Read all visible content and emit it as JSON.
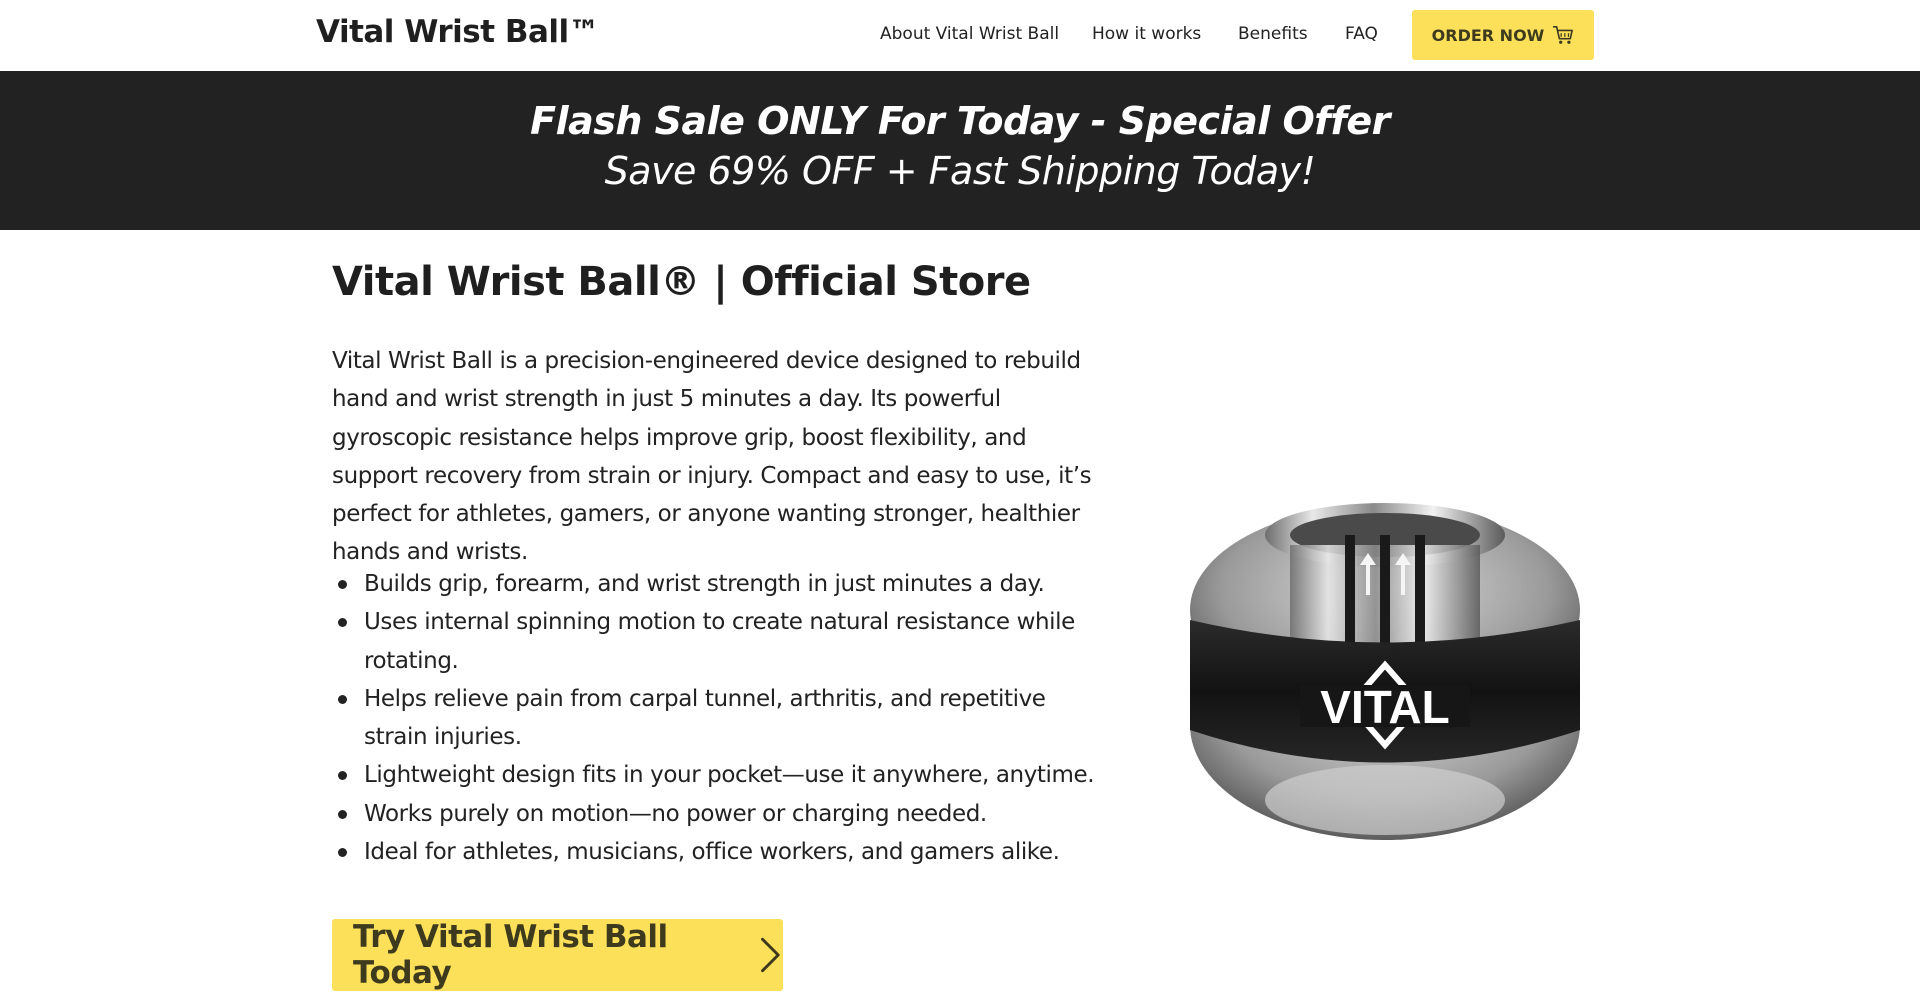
{
  "header": {
    "logo": "Vital Wrist Ball™",
    "nav": [
      "About Vital Wrist Ball",
      "How it works",
      "Benefits",
      "FAQ"
    ],
    "order_button": "ORDER NOW",
    "order_icon": "cart-icon"
  },
  "banner": {
    "line1": "Flash Sale ONLY For Today - Special Offer",
    "line2": "Save 69% OFF + Fast Shipping Today!"
  },
  "main": {
    "title": "Vital Wrist Ball® | Official Store",
    "description": "Vital Wrist Ball is a precision-engineered device designed to rebuild hand and wrist strength in just 5 minutes a day. Its powerful gyroscopic resistance helps improve grip, boost flexibility, and support recovery from strain or injury. Compact and easy to use, it’s perfect for athletes, gamers, or anyone wanting stronger, healthier hands and wrists.",
    "features": [
      "Builds grip, forearm, and wrist strength in just minutes a day.",
      "Uses internal spinning motion to create natural resistance while rotating.",
      "Helps relieve pain from carpal tunnel, arthritis, and repetitive strain injuries.",
      "Lightweight design fits in your pocket—use it anywhere, anytime.",
      "Works purely on motion—no power or charging needed.",
      "Ideal for athletes, musicians, office workers, and gamers alike."
    ],
    "cta_button": "Try Vital Wrist Ball Today",
    "cta_icon": "chevron-right-icon"
  },
  "product_image": {
    "brand_text": "VITAL"
  },
  "colors": {
    "accent": "#fde05a",
    "banner_bg": "#222222",
    "text": "#222222"
  }
}
